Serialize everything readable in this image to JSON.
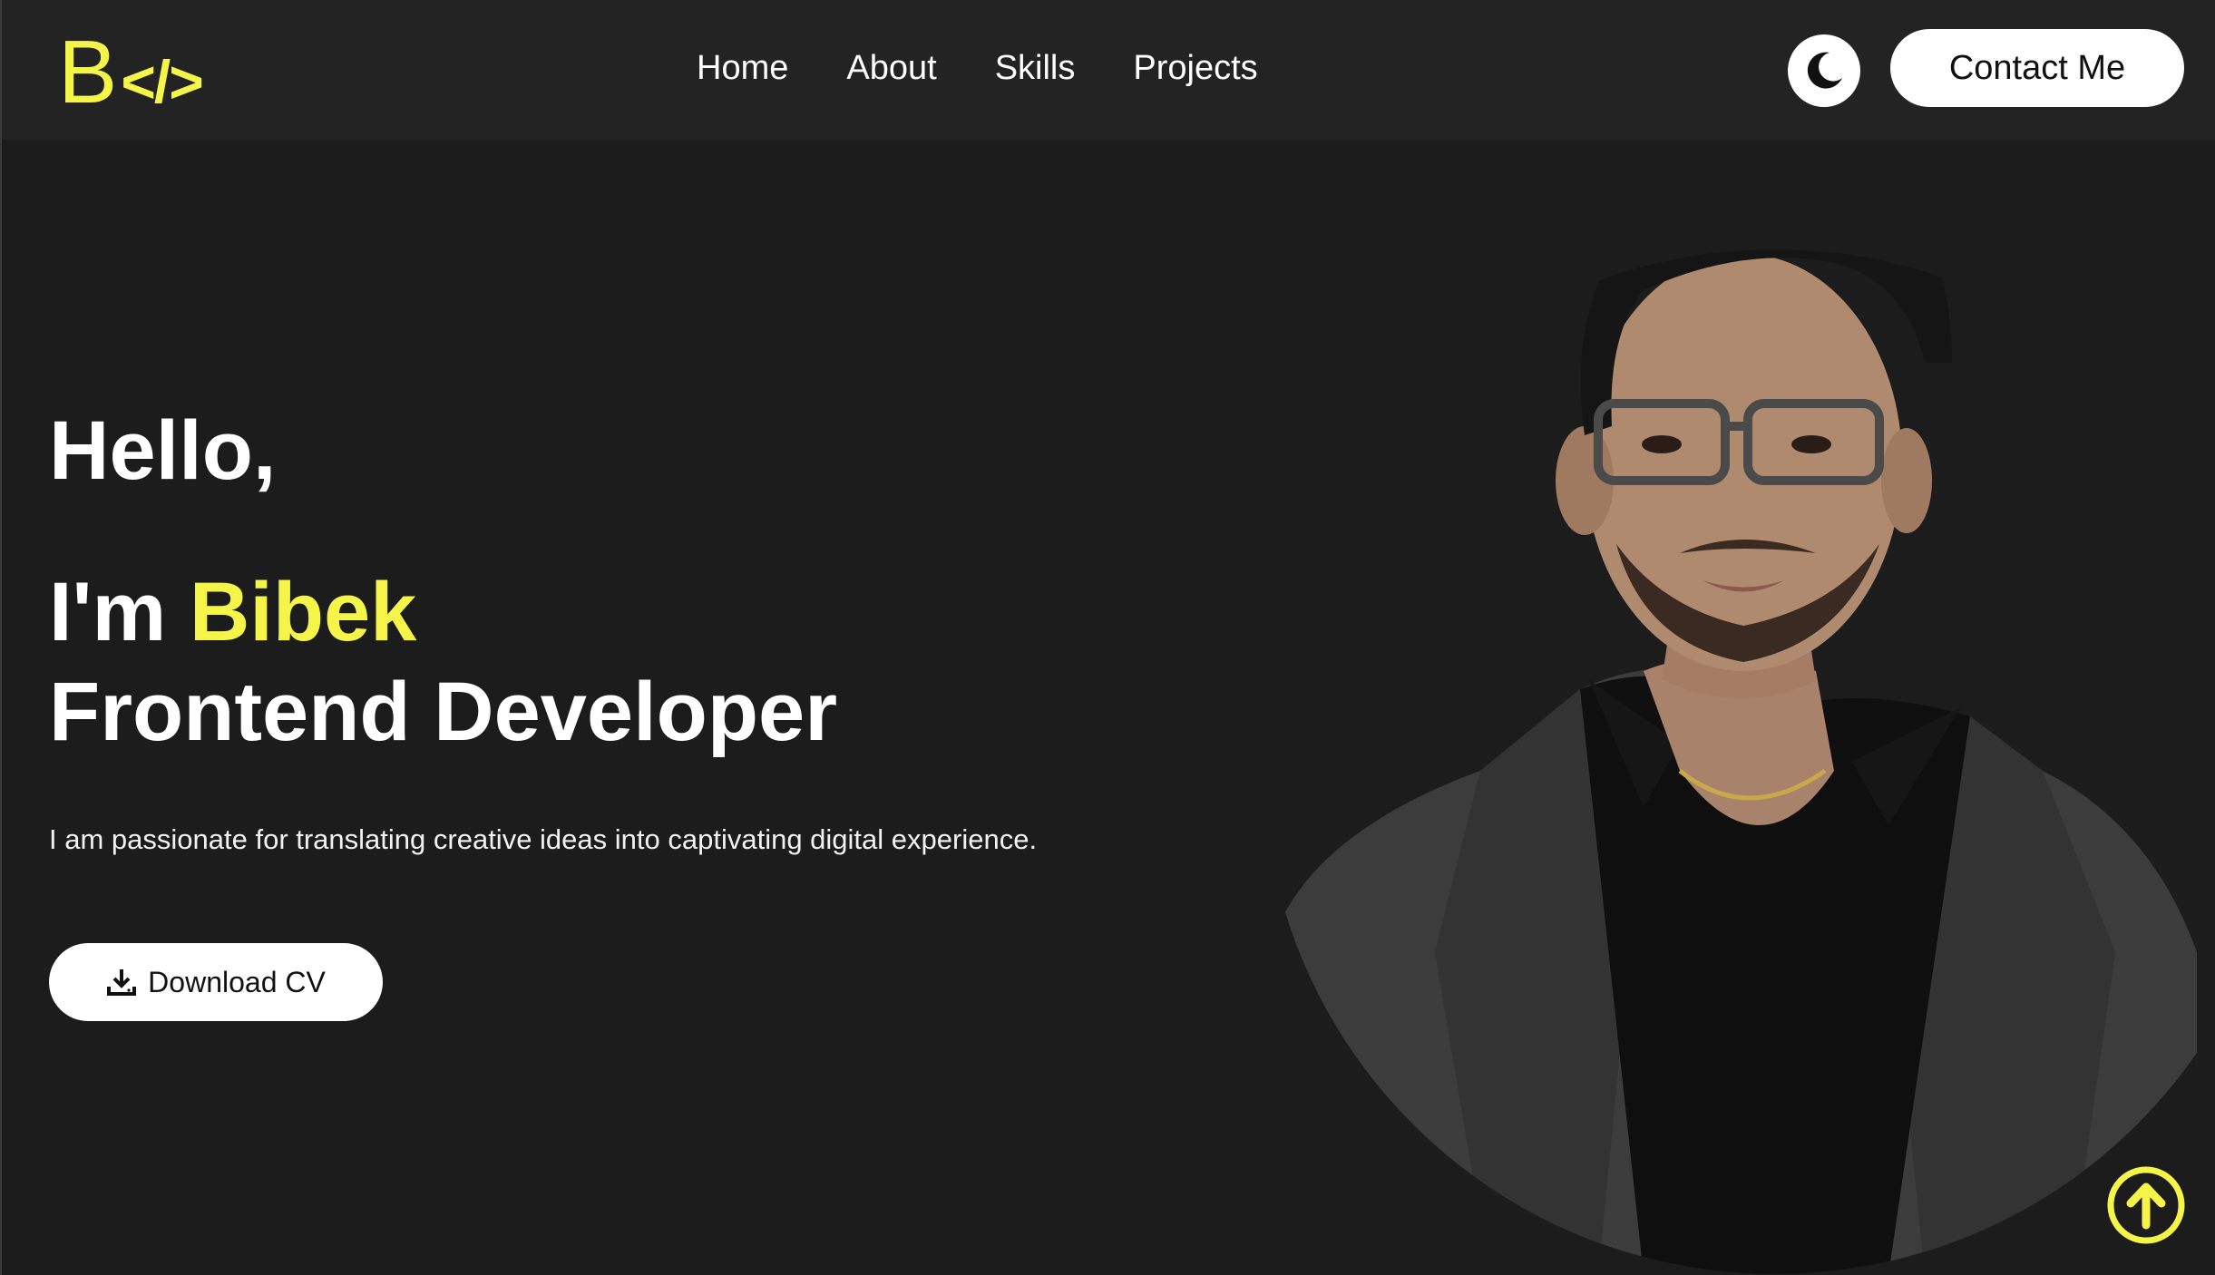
{
  "header": {
    "logo": {
      "letter": "B",
      "code": "</>"
    },
    "nav": [
      {
        "label": "Home"
      },
      {
        "label": "About"
      },
      {
        "label": "Skills"
      },
      {
        "label": "Projects"
      }
    ],
    "theme_icon": "moon-icon",
    "contact_label": "Contact Me"
  },
  "hero": {
    "greeting": "Hello,",
    "im_prefix": "I'm ",
    "name": "Bibek",
    "role": "Frontend Developer",
    "tagline": "I am passionate for translating creative ideas into captivating digital experience.",
    "download_label": "Download CV",
    "download_icon": "download-icon"
  },
  "scroll_top_icon": "arrow-up-circle-icon",
  "colors": {
    "accent": "#f5f549",
    "background": "#1c1c1c",
    "header_background": "#232323",
    "button_background": "#ffffff"
  }
}
